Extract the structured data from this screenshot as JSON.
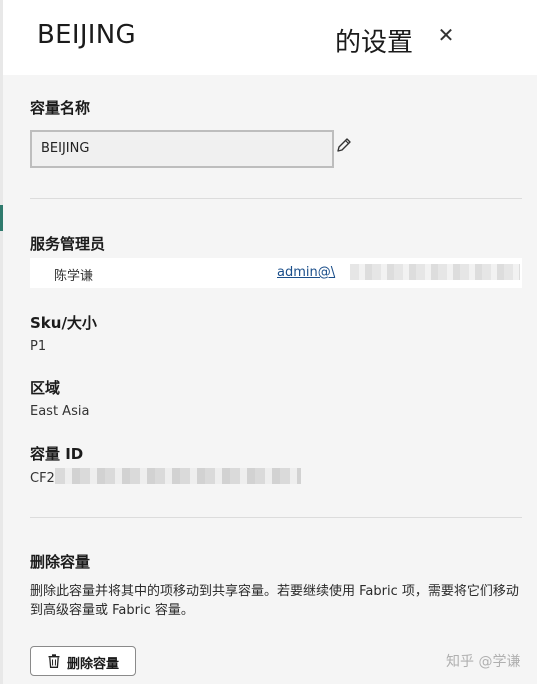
{
  "header": {
    "capacity_name": "BEIJING",
    "title": "的设置",
    "close_icon": "close-icon"
  },
  "capacity_name_section": {
    "label": "容量名称",
    "input_value": "BEIJING",
    "edit_icon": "pencil-icon"
  },
  "admins_section": {
    "label": "服务管理员",
    "admins": [
      {
        "name": "陈学谦",
        "email": "admin@\\"
      }
    ]
  },
  "sku_section": {
    "label": "Sku/大小",
    "value": "P1"
  },
  "region_section": {
    "label": "区域",
    "value": "East Asia"
  },
  "capacity_id_section": {
    "label": "容量 ID",
    "value_prefix": "CF2"
  },
  "delete_section": {
    "label": "删除容量",
    "description": "删除此容量并将其中的项移动到共享容量。若要继续使用 Fabric 项，需要将它们移动到高级容量或 Fabric 容量。",
    "button_label": "删除容量",
    "button_icon": "trash-icon"
  },
  "watermark": "知乎 @学谦",
  "colors": {
    "link": "#1a4e8a",
    "left_accent": "#2f7a6d",
    "header_bg": "#ffffff",
    "panel_bg": "#f5f5f5"
  }
}
